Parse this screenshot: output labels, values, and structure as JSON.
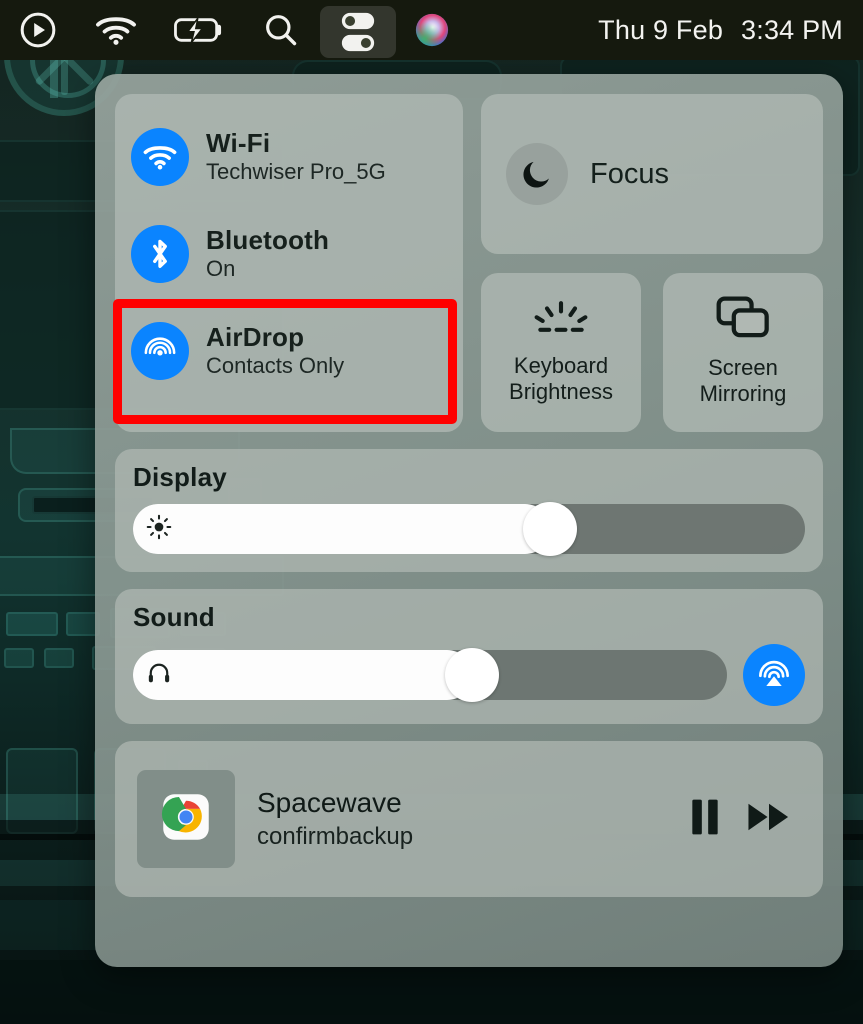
{
  "menubar": {
    "items": [
      {
        "name": "now-playing-icon",
        "label": "Now Playing"
      },
      {
        "name": "wifi-icon",
        "label": "Wi-Fi"
      },
      {
        "name": "battery-charging-icon",
        "label": "Battery Charging"
      },
      {
        "name": "spotlight-search-icon",
        "label": "Spotlight Search"
      },
      {
        "name": "control-center-icon",
        "label": "Control Center"
      },
      {
        "name": "siri-icon",
        "label": "Siri"
      }
    ],
    "date": "Thu 9 Feb",
    "time": "3:34 PM"
  },
  "control_center": {
    "connectivity": [
      {
        "icon": "wifi-icon",
        "title": "Wi-Fi",
        "subtitle": "Techwiser Pro_5G",
        "active": true,
        "accent": "#0a84ff"
      },
      {
        "icon": "bluetooth-icon",
        "title": "Bluetooth",
        "subtitle": "On",
        "active": true,
        "accent": "#0a84ff"
      },
      {
        "icon": "airdrop-icon",
        "title": "AirDrop",
        "subtitle": "Contacts Only",
        "active": true,
        "accent": "#0a84ff"
      }
    ],
    "focus": {
      "icon": "moon-icon",
      "label": "Focus",
      "active": false
    },
    "tiles": [
      {
        "icon": "keyboard-brightness-icon",
        "line1": "Keyboard",
        "line2": "Brightness"
      },
      {
        "icon": "screen-mirroring-icon",
        "line1": "Screen",
        "line2": "Mirroring"
      }
    ],
    "display": {
      "label": "Display",
      "icon": "brightness-sun-icon",
      "value": 62
    },
    "sound": {
      "label": "Sound",
      "icon": "headphones-icon",
      "value": 57,
      "output_icon": "airplay-icon",
      "output_accent": "#0a84ff"
    },
    "now_playing": {
      "artwork_icon": "chrome-icon",
      "title": "Spacewave",
      "subtitle": "confirmbackup",
      "pause_icon": "pause-icon",
      "forward_icon": "fast-forward-icon"
    }
  },
  "annotation": {
    "name": "airdrop-highlight-box",
    "color": "#ff0000"
  }
}
